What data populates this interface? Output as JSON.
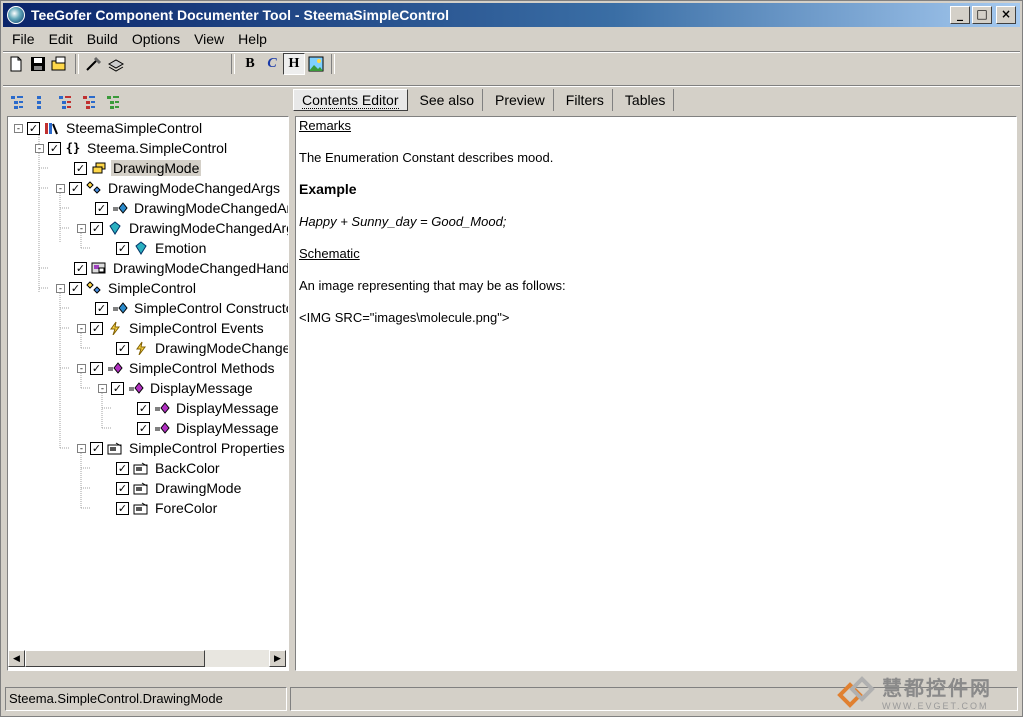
{
  "window": {
    "title": "TeeGofer Component Documenter Tool - SteemaSimpleControl",
    "buttons": {
      "minimize": "_",
      "maximize": "□",
      "close": "×"
    }
  },
  "menubar": {
    "items": [
      {
        "label": "File"
      },
      {
        "label": "Edit"
      },
      {
        "label": "Build"
      },
      {
        "label": "Options"
      },
      {
        "label": "View"
      },
      {
        "label": "Help"
      }
    ]
  },
  "toolbar": {
    "bold_label": "B",
    "italic_label": "C",
    "heading_label": "H"
  },
  "tree": {
    "nodes": [
      {
        "label": "SteemaSimpleControl",
        "icon": "library-icon",
        "expand": "-"
      },
      {
        "label": "Steema.SimpleControl",
        "icon": "namespace-icon",
        "expand": "-"
      },
      {
        "label": "DrawingMode",
        "icon": "enum-icon",
        "expand": ""
      },
      {
        "label": "DrawingModeChangedArgs",
        "icon": "class-icon",
        "expand": "-"
      },
      {
        "label": "DrawingModeChangedArgs Constructor",
        "icon": "constructor-icon",
        "expand": ""
      },
      {
        "label": "DrawingModeChangedArgs Fields",
        "icon": "field-icon",
        "expand": "-"
      },
      {
        "label": "Emotion",
        "icon": "field-icon",
        "expand": ""
      },
      {
        "label": "DrawingModeChangedHandler",
        "icon": "delegate-icon",
        "expand": ""
      },
      {
        "label": "SimpleControl",
        "icon": "class-icon",
        "expand": "-"
      },
      {
        "label": "SimpleControl Constructor",
        "icon": "constructor-icon",
        "expand": ""
      },
      {
        "label": "SimpleControl Events",
        "icon": "event-icon",
        "expand": "-"
      },
      {
        "label": "DrawingModeChanged",
        "icon": "event-icon",
        "expand": ""
      },
      {
        "label": "SimpleControl Methods",
        "icon": "method-icon",
        "expand": "-"
      },
      {
        "label": "DisplayMessage",
        "icon": "method-icon",
        "expand": "-"
      },
      {
        "label": "DisplayMessage",
        "icon": "method-icon",
        "expand": ""
      },
      {
        "label": "DisplayMessage",
        "icon": "method-icon",
        "expand": ""
      },
      {
        "label": "SimpleControl Properties",
        "icon": "property-icon",
        "expand": "-"
      },
      {
        "label": "BackColor",
        "icon": "property-icon",
        "expand": ""
      },
      {
        "label": "DrawingMode",
        "icon": "property-icon",
        "expand": ""
      },
      {
        "label": "ForeColor",
        "icon": "property-icon",
        "expand": ""
      }
    ]
  },
  "tabs": [
    {
      "label": "Contents Editor"
    },
    {
      "label": "See also"
    },
    {
      "label": "Preview"
    },
    {
      "label": "Filters"
    },
    {
      "label": "Tables"
    }
  ],
  "editor": {
    "remarks": "Remarks",
    "description": "The Enumeration Constant describes mood.",
    "example_heading": "Example",
    "example_code": "Happy + Sunny_day = Good_Mood;",
    "schematic": "Schematic",
    "image_text": "An image representing that may be as follows:",
    "img_tag": "<IMG SRC=\"images\\molecule.png\">"
  },
  "status": {
    "path": "Steema.SimpleControl.DrawingMode"
  },
  "watermark": {
    "brand": "慧都控件网",
    "url": "WWW.EVGET.COM"
  }
}
